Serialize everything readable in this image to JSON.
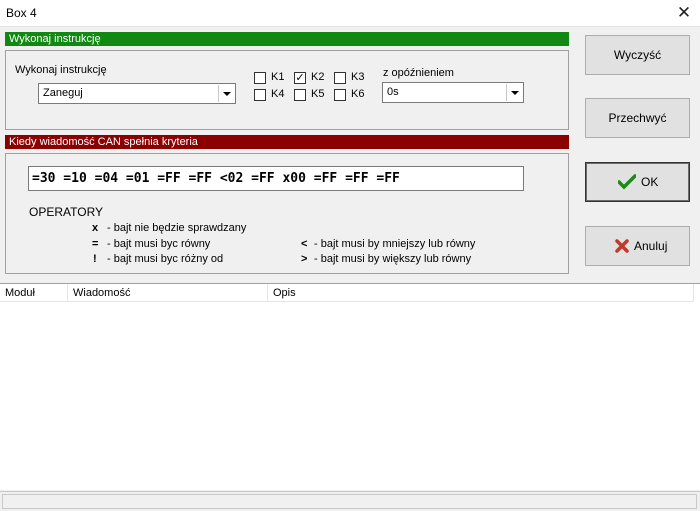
{
  "window": {
    "title": "Box 4",
    "close_glyph": "✕"
  },
  "section1": {
    "header": "Wykonaj instrukcję",
    "instruction_label": "Wykonaj instrukcję",
    "instruction_value": "Zaneguj",
    "checkboxes": [
      {
        "label": "K1",
        "checked": false
      },
      {
        "label": "K2",
        "checked": true
      },
      {
        "label": "K3",
        "checked": false
      },
      {
        "label": "K4",
        "checked": false
      },
      {
        "label": "K5",
        "checked": false
      },
      {
        "label": "K6",
        "checked": false
      }
    ],
    "delay_label": "z opóźnieniem",
    "delay_value": "0s"
  },
  "section2": {
    "header": "Kiedy wiadomość CAN spełnia kryteria",
    "filter_value": "=30 =10 =04 =01 =FF =FF <02 =FF x00 =FF =FF =FF",
    "operators_label": "OPERATORY",
    "operators": [
      {
        "symbol": "x",
        "text": "- bajt nie będzie sprawdzany"
      },
      {
        "symbol": "=",
        "text": "- bajt musi byc równy"
      },
      {
        "symbol": "!",
        "text": "- bajt musi byc różny od"
      },
      {
        "symbol": "<",
        "text": "- bajt musi by mniejszy lub równy"
      },
      {
        "symbol": ">",
        "text": "- bajt musi by większy lub równy"
      }
    ]
  },
  "buttons": {
    "clear": "Wyczyść",
    "capture": "Przechwyć",
    "ok": "OK",
    "cancel": "Anuluj"
  },
  "table": {
    "columns": [
      "Moduł",
      "Wiadomość",
      "Opis"
    ]
  },
  "colors": {
    "ok_check": "#1a8a1a",
    "cancel_x": "#c0392b",
    "section1_bar": "#118811",
    "section2_bar": "#8b0000"
  }
}
